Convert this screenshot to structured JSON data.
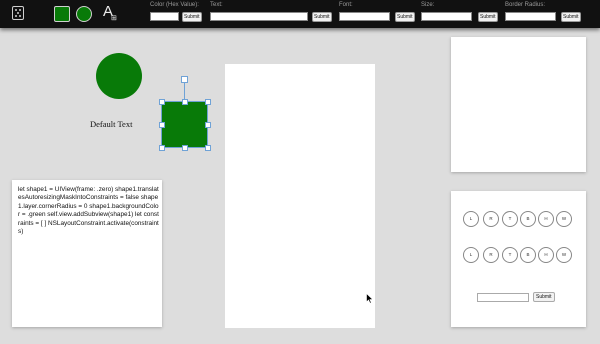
{
  "toolbar": {
    "fields": [
      {
        "label": "Color (Hex Value):",
        "button": "Submit"
      },
      {
        "label": "Text:",
        "button": "Submit"
      },
      {
        "label": "Font:",
        "button": "Submit"
      },
      {
        "label": "Size:",
        "button": "Submit"
      },
      {
        "label": "Border Radius:",
        "button": "Submit"
      }
    ],
    "tools": [
      "dice-icon",
      "square-tool-icon",
      "circle-tool-icon",
      "text-tool-icon"
    ],
    "accent_color": "#087a08"
  },
  "canvas": {
    "text_shape": "Default Text",
    "shape_color": "#087a08"
  },
  "code_panel": {
    "code": "let shape1 = UIView(frame: .zero) shape1.translatesAutoresizingMaskIntoConstraints = false shape1.layer.cornerRadius = 0 shape1.backgroundColor = .green self.view.addSubview(shape1) let constraints = [ ] NSLayoutConstraint.activate(constraints)"
  },
  "radius_panel": {
    "row1": [
      "L",
      "R",
      "T",
      "B",
      "H",
      "W"
    ],
    "row2": [
      "L",
      "R",
      "T",
      "B",
      "H",
      "W"
    ],
    "submit": "Submit",
    "input_value": ""
  }
}
